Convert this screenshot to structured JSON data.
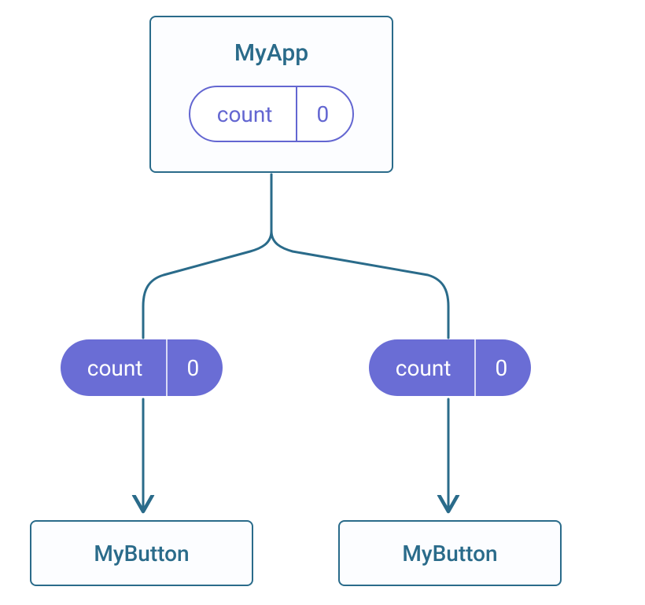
{
  "colors": {
    "box_border": "#2a6b8a",
    "box_bg": "#fcfdff",
    "text": "#2a6b8a",
    "pill_outline": "#6366d1",
    "pill_fill": "#6a6dd5",
    "connector": "#2a6b8a"
  },
  "parent": {
    "title": "MyApp",
    "state": {
      "label": "count",
      "value": "0"
    }
  },
  "children": [
    {
      "prop": {
        "label": "count",
        "value": "0"
      },
      "name": "MyButton"
    },
    {
      "prop": {
        "label": "count",
        "value": "0"
      },
      "name": "MyButton"
    }
  ]
}
